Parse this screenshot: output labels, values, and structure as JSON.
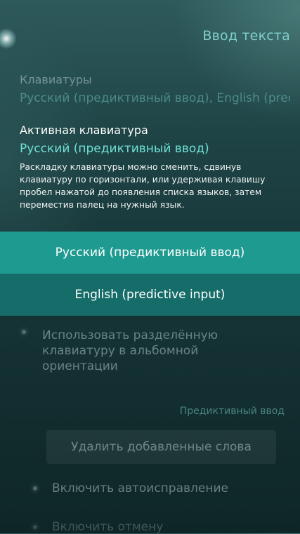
{
  "header": {
    "title": "Ввод текста"
  },
  "keyboards": {
    "label": "Клавиатуры",
    "value": "Русский (предиктивный ввод), English (predictive input)"
  },
  "active_keyboard": {
    "label": "Активная клавиатура",
    "value": "Русский (предиктивный ввод)",
    "description": "Раскладку клавиатуры можно сменить, сдвинув клавиатуру по горизонтали, или удерживая клавишу пробел нажатой до появления списка языков, затем переместив палец на нужный язык."
  },
  "options": [
    {
      "label": "Русский (предиктивный ввод)",
      "selected": true
    },
    {
      "label": "English (predictive input)",
      "selected": false
    }
  ],
  "split_keyboard": {
    "label": "Использовать разделённую клавиатуру в альбомной ориентации"
  },
  "predictive_input": {
    "header": "Предиктивный ввод",
    "delete_words_label": "Удалить добавленные слова",
    "autocorrect_label": "Включить автоисправление",
    "undo_label": "Включить отмену"
  },
  "colors": {
    "accent": "#6fe0d4",
    "selected_option_bg": "#1f9a90",
    "option_bg": "#156c68"
  }
}
